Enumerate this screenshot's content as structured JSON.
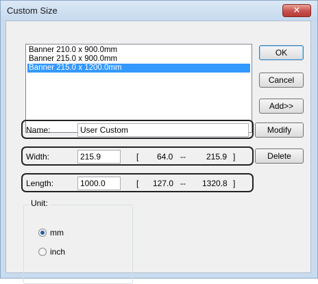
{
  "window": {
    "title": "Custom Size",
    "close_glyph": "✕"
  },
  "list": {
    "items": [
      "Banner 210.0 x 900.0mm",
      "Banner 215.0 x 900.0mm",
      "Banner 215.0 x 1200.0mm"
    ],
    "selected_index": 2
  },
  "buttons": {
    "ok": "OK",
    "cancel": "Cancel",
    "add": "Add>>",
    "modify": "Modify",
    "delete": "Delete"
  },
  "fields": {
    "name": {
      "label": "Name:",
      "value": "User Custom"
    },
    "width": {
      "label": "Width:",
      "value": "215.9",
      "range_open": "[",
      "min": "64.0",
      "sep": "--",
      "max": "215.9",
      "range_close": "]"
    },
    "length": {
      "label": "Length:",
      "value": "1000.0",
      "range_open": "[",
      "min": "127.0",
      "sep": "--",
      "max": "1320.8",
      "range_close": "]"
    }
  },
  "unit": {
    "title": "Unit:",
    "options": [
      {
        "label": "mm",
        "selected": true
      },
      {
        "label": "inch",
        "selected": false
      }
    ]
  },
  "colors": {
    "selection": "#3399ff",
    "close_button": "#c75050",
    "frame": "#c9dcef"
  }
}
